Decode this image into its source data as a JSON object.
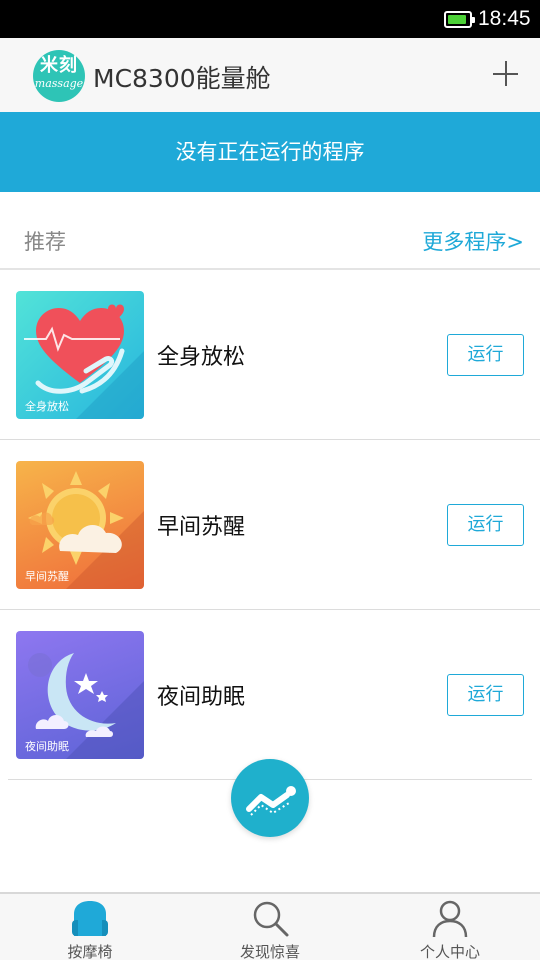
{
  "status_bar": {
    "time": "18:45",
    "battery_level": 0.9,
    "battery_color": "#4cd137"
  },
  "header": {
    "logo_text": "米刻",
    "logo_subtext": "massage",
    "title": "MC8300能量舱",
    "add_icon": "plus-icon"
  },
  "banner": {
    "text": "没有正在运行的程序",
    "color": "#1fa9d8"
  },
  "recommend": {
    "title": "推荐",
    "more_link": "更多程序>"
  },
  "programs": [
    {
      "name": "全身放松",
      "thumb_label": "全身放松",
      "icon": "heart-hands-icon",
      "run_label": "运行"
    },
    {
      "name": "早间苏醒",
      "thumb_label": "早间苏醒",
      "icon": "sun-cloud-icon",
      "run_label": "运行"
    },
    {
      "name": "夜间助眠",
      "thumb_label": "夜间助眠",
      "icon": "moon-stars-icon",
      "run_label": "运行"
    }
  ],
  "fab": {
    "icon": "massage-chair-icon"
  },
  "tab_bar": {
    "tabs": [
      {
        "label": "按摩椅",
        "icon": "chair-icon",
        "active": true
      },
      {
        "label": "发现惊喜",
        "icon": "search-icon",
        "active": false
      },
      {
        "label": "个人中心",
        "icon": "person-icon",
        "active": false
      }
    ]
  },
  "accent_color": "#1fa9d8"
}
